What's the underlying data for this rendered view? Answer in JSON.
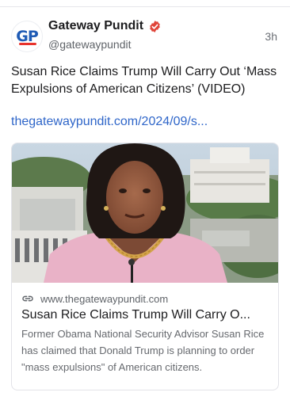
{
  "post": {
    "author": {
      "display_name": "Gateway Pundit",
      "handle": "@gatewaypundit",
      "avatar_text": "GP",
      "verified": true
    },
    "timestamp": "3h",
    "text": "Susan Rice Claims Trump Will Carry Out ‘Mass Expulsions of American Citizens’ (VIDEO)",
    "link_text": "thegatewaypundit.com/2024/09/s..."
  },
  "card": {
    "domain": "www.thegatewaypundit.com",
    "title": "Susan Rice Claims Trump Will Carry O...",
    "description": "Former Obama National Security Advisor Susan Rice has claimed that Donald Trump is planning to order \"mass expulsions\" of American citizens.",
    "image_icon": "news-thumbnail"
  },
  "colors": {
    "link": "#2f66c9",
    "verified_badge": "#e0453a",
    "avatar_blue": "#1f5bb5",
    "avatar_red": "#e8322b",
    "jacket_pink": "#e9b2c7"
  },
  "icons": {
    "verified": "verified-badge-icon",
    "link": "link-icon"
  }
}
